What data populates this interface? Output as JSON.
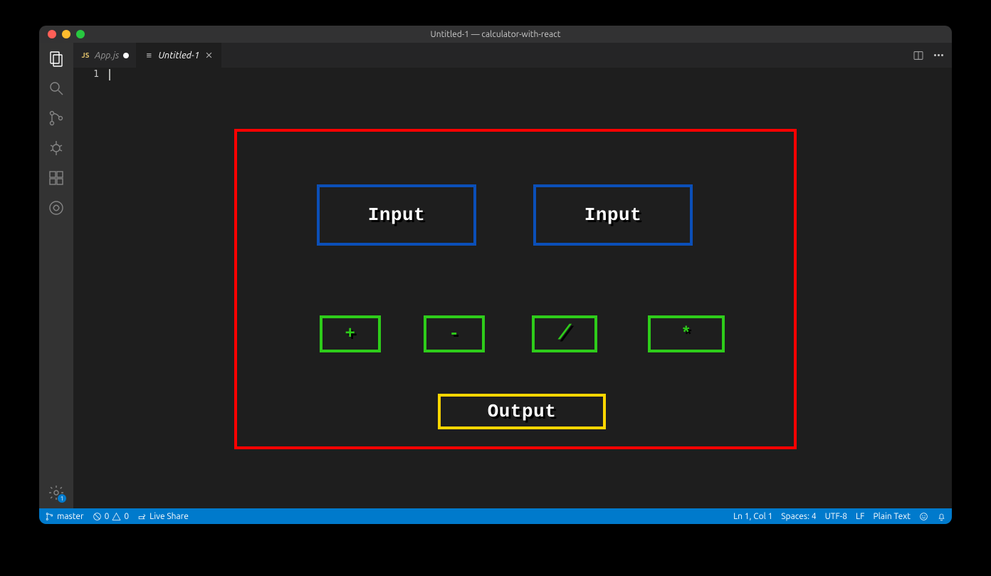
{
  "window": {
    "title": "Untitled-1 — calculator-with-react"
  },
  "tabs": [
    {
      "label": "App.js",
      "icon": "JS",
      "dirty": true
    },
    {
      "label": "Untitled-1",
      "icon": "≡",
      "active": true
    }
  ],
  "editor": {
    "line_number": "1"
  },
  "diagram": {
    "input_a": "Input",
    "input_b": "Input",
    "op_plus": "+",
    "op_minus": "-",
    "op_div": "/",
    "op_mul": "*",
    "output": "Output"
  },
  "activitybar": {
    "gear_badge": "1"
  },
  "statusbar": {
    "branch": "master",
    "errors": "0",
    "warnings": "0",
    "live_share": "Live Share",
    "cursor": "Ln 1, Col 1",
    "spaces": "Spaces: 4",
    "encoding": "UTF-8",
    "eol": "LF",
    "language": "Plain Text"
  }
}
